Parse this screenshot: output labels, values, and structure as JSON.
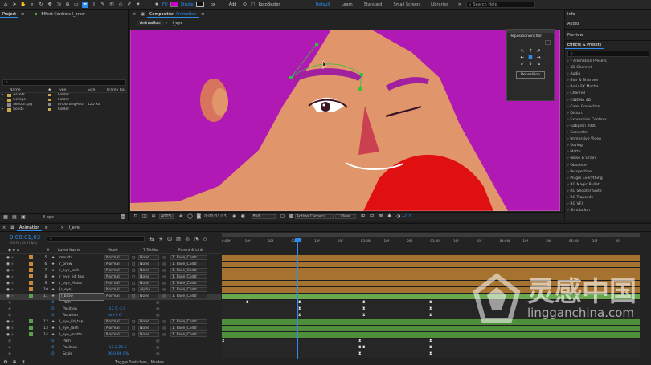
{
  "toolbar": {
    "fill_label": "Fill",
    "stroke_label": "Stroke",
    "stroke_value": "px",
    "add_label": "Add",
    "rotobezier_label": "RotoBezier",
    "fill_color": "#cc00cc",
    "workspaces": [
      "Default",
      "Learn",
      "Standard",
      "Small Screen",
      "Libraries"
    ],
    "search_placeholder": "Search Help"
  },
  "project": {
    "tab_project": "Project",
    "tab_effect_controls": "Effect Controls l_brow",
    "columns": [
      "Name",
      "Type",
      "Size",
      "Frame Ra..."
    ],
    "items": [
      {
        "name": "Assets",
        "type": "Folder",
        "size": "",
        "color": "#c9a94a",
        "folder": true
      },
      {
        "name": "Comps",
        "type": "Folder",
        "size": "",
        "color": "#c9a94a",
        "folder": true
      },
      {
        "name": "Sketch.jpg",
        "type": "ImportedJPEG",
        "size": "125 KB",
        "color": "#8a8a8a",
        "folder": false
      },
      {
        "name": "Solids",
        "type": "Folder",
        "size": "",
        "color": "#c9a94a",
        "folder": true
      }
    ],
    "bpc": "8 bpc"
  },
  "composition": {
    "panel_label": "Composition",
    "panel_name": "Animation",
    "breadcrumb": [
      "Animation",
      "l_eye"
    ],
    "zoom": "400%",
    "timecode": "0;00;01;03",
    "resolution": "Full",
    "camera": "Active Camera",
    "view": "1 View",
    "exposure": "+0.0"
  },
  "reposition_anchor": {
    "title": "RepositionAnchor",
    "button_label": "Reposition"
  },
  "effects": {
    "tab_info": "Info",
    "tab_audio": "Audio",
    "tab_preview": "Preview",
    "tab_effects": "Effects & Presets",
    "search_placeholder": "",
    "items": [
      "* Animation Presets",
      "3D Channel",
      "Audio",
      "Blur & Sharpen",
      "Boris FX Mocha",
      "Channel",
      "CINEMA 4D",
      "Color Correction",
      "Distort",
      "Expression Controls",
      "Gabgren 2000",
      "Generate",
      "Immersive Video",
      "Keying",
      "Matte",
      "Noise & Grain",
      "Obsolete",
      "Perspective",
      "Plugin Everything",
      "RG Magic Bullet",
      "RG Shooter Suite",
      "RG Trapcode",
      "RG VFX",
      "Simulation"
    ]
  },
  "timeline": {
    "tab_active": "Animation",
    "tab_other": "l_eye",
    "timecode": "0;00;01;03",
    "fps_text": "00033 (29.97 fps)",
    "columns": {
      "num": "#",
      "layer_name": "Layer Name",
      "mode": "Mode",
      "trkmat": "T TrkMat",
      "parent": "Parent & Link"
    },
    "ruler": [
      "0:00f",
      "10f",
      "20f",
      "01:00f",
      "10f",
      "20f",
      "02:00f",
      "10f",
      "20f",
      "03:00f",
      "10f",
      "20f",
      "04:00f",
      "10f",
      "20f",
      "05:00f",
      "10f",
      "20f"
    ],
    "footer_label": "Toggle Switches / Modes",
    "layers": [
      {
        "num": "5",
        "name": "mouth",
        "mode": "Normal",
        "trkmat": "None",
        "parent": "1. Face_Contr",
        "color": "#c88a3a",
        "kind": "layer"
      },
      {
        "num": "6",
        "name": "r_brow",
        "mode": "Normal",
        "trkmat": "None",
        "parent": "1. Face_Contr",
        "color": "#c88a3a",
        "kind": "layer"
      },
      {
        "num": "7",
        "name": "r_eye_lash",
        "mode": "Normal",
        "trkmat": "None",
        "parent": "1. Face_Contr",
        "color": "#c88a3a",
        "kind": "layer"
      },
      {
        "num": "8",
        "name": "r_eye_lid_top",
        "mode": "Normal",
        "trkmat": "None",
        "parent": "1. Face_Contr",
        "color": "#c88a3a",
        "kind": "layer"
      },
      {
        "num": "9",
        "name": "r_eye_Matte",
        "mode": "Normal",
        "trkmat": "None",
        "parent": "1. Face_Contr",
        "color": "#c88a3a",
        "kind": "layer"
      },
      {
        "num": "10",
        "name": "[r_eye]",
        "mode": "Normal",
        "trkmat": "Alpha",
        "parent": "1. Face_Contr",
        "color": "#c88a3a",
        "kind": "layer"
      },
      {
        "num": "11",
        "name": "l_brow",
        "mode": "Normal",
        "trkmat": "None",
        "parent": "1. Face_Contr",
        "color": "#5aa04c",
        "kind": "layer-selected"
      },
      {
        "num": "",
        "name": "Path",
        "mode": "",
        "trkmat": "",
        "parent": "",
        "color": "",
        "kind": "prop"
      },
      {
        "num": "",
        "name": "Position",
        "mode": "-12.5,-2.9",
        "trkmat": "",
        "parent": "",
        "color": "",
        "kind": "prop"
      },
      {
        "num": "",
        "name": "Rotation",
        "mode": "0x+9.0°",
        "trkmat": "",
        "parent": "",
        "color": "",
        "kind": "prop"
      },
      {
        "num": "12",
        "name": "l_eye_lid_top",
        "mode": "Normal",
        "trkmat": "None",
        "parent": "1. Face_Contr",
        "color": "#5aa04c",
        "kind": "layer"
      },
      {
        "num": "13",
        "name": "l_eye_lash",
        "mode": "Normal",
        "trkmat": "None",
        "parent": "1. Face_Contr",
        "color": "#5aa04c",
        "kind": "layer"
      },
      {
        "num": "14",
        "name": "l_eye_matte",
        "mode": "Normal",
        "trkmat": "None",
        "parent": "1. Face_Contr",
        "color": "#5aa04c",
        "kind": "layer"
      },
      {
        "num": "",
        "name": "Path",
        "mode": "",
        "trkmat": "",
        "parent": "",
        "color": "",
        "kind": "prop"
      },
      {
        "num": "",
        "name": "Position",
        "mode": "-12.0,25.6",
        "trkmat": "",
        "parent": "",
        "color": "",
        "kind": "prop"
      },
      {
        "num": "",
        "name": "Scale",
        "mode": "96.0,96.0%",
        "trkmat": "",
        "parent": "",
        "color": "",
        "kind": "prop"
      }
    ]
  },
  "watermark": {
    "title": "灵感中国",
    "url": "lingganchina.com"
  },
  "colors": {
    "accent": "#2d8ceb",
    "purple_hair": "#b019b3",
    "skin": "#e0956a",
    "red_shirt": "#e01010",
    "orange_track": "#a5722f",
    "green_track": "#4f8f3c"
  }
}
